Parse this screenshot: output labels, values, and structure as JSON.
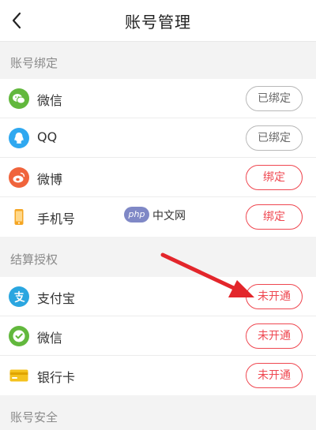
{
  "header": {
    "title": "账号管理",
    "back_icon": "chevron-left-icon"
  },
  "sections": {
    "binding": {
      "title": "账号绑定",
      "items": [
        {
          "label": "微信",
          "icon": "wechat-icon",
          "button": "已绑定",
          "status": "bound"
        },
        {
          "label": "QQ",
          "icon": "qq-icon",
          "button": "已绑定",
          "status": "bound"
        },
        {
          "label": "微博",
          "icon": "weibo-icon",
          "button": "绑定",
          "status": "unbound"
        },
        {
          "label": "手机号",
          "icon": "phone-icon",
          "button": "绑定",
          "status": "unbound"
        }
      ]
    },
    "settlement": {
      "title": "结算授权",
      "items": [
        {
          "label": "支付宝",
          "icon": "alipay-icon",
          "button": "未开通",
          "status": "inactive"
        },
        {
          "label": "微信",
          "icon": "wechat-pay-icon",
          "button": "未开通",
          "status": "inactive"
        },
        {
          "label": "银行卡",
          "icon": "bank-card-icon",
          "button": "未开通",
          "status": "inactive"
        }
      ]
    },
    "security": {
      "title": "账号安全"
    }
  },
  "watermark": {
    "logo": "php",
    "text": "中文网"
  },
  "colors": {
    "accent": "#ef4750",
    "wechat": "#62b83d",
    "qq": "#2fa8f0",
    "weibo": "#f0643c",
    "phone": "#f5a623",
    "alipay": "#2aa6e0",
    "bank_card": "#f4c21d",
    "annotation_arrow": "#e3262b"
  }
}
